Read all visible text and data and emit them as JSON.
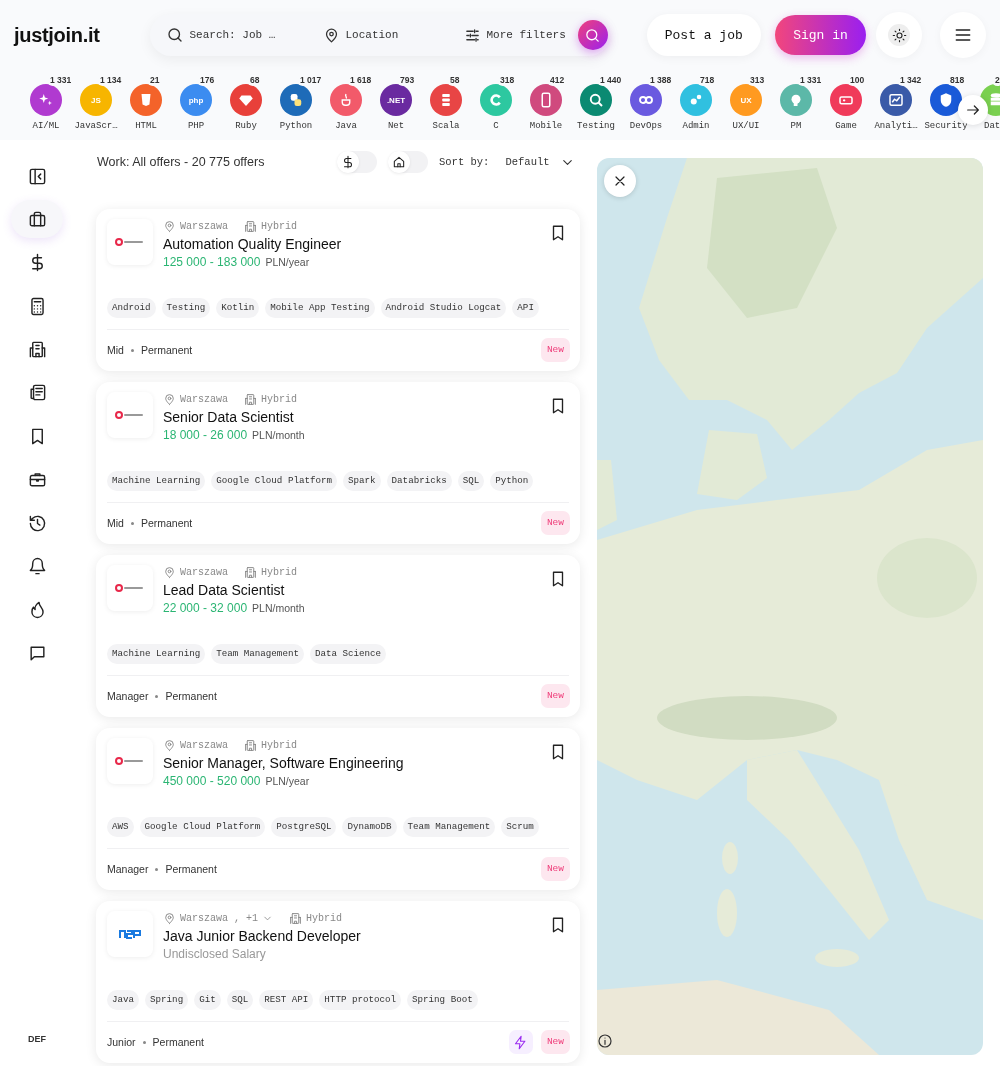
{
  "logo": "justjoin.it",
  "search": {
    "placeholder": "Search: Job …"
  },
  "location": {
    "placeholder": "Location"
  },
  "more_filters": "More filters",
  "post_job": "Post a job",
  "sign_in": "Sign in",
  "categories": [
    {
      "label": "AI/ML",
      "count": "1 331",
      "color": "#b03ad0"
    },
    {
      "label": "JavaScr…",
      "count": "1 134",
      "color": "#f7b500",
      "glyph_text": "JS"
    },
    {
      "label": "HTML",
      "count": "21",
      "color": "#f4632a"
    },
    {
      "label": "PHP",
      "count": "176",
      "color": "#3c8cf0",
      "glyph_text": "php"
    },
    {
      "label": "Ruby",
      "count": "68",
      "color": "#e8403a"
    },
    {
      "label": "Python",
      "count": "1 017",
      "color": "#1e6bb8"
    },
    {
      "label": "Java",
      "count": "1 618",
      "color": "#f25a6a"
    },
    {
      "label": "Net",
      "count": "793",
      "color": "#6a2aa0",
      "glyph_text": ".NET"
    },
    {
      "label": "Scala",
      "count": "58",
      "color": "#e84545"
    },
    {
      "label": "C",
      "count": "318",
      "color": "#2dc8a0"
    },
    {
      "label": "Mobile",
      "count": "412",
      "color": "#d04a7e"
    },
    {
      "label": "Testing",
      "count": "1 440",
      "color": "#0b8a72"
    },
    {
      "label": "DevOps",
      "count": "1 388",
      "color": "#6a5ae0"
    },
    {
      "label": "Admin",
      "count": "718",
      "color": "#30c0e0"
    },
    {
      "label": "UX/UI",
      "count": "313",
      "color": "#ff9a20",
      "glyph_text": "UX"
    },
    {
      "label": "PM",
      "count": "1 331",
      "color": "#5cb8a8"
    },
    {
      "label": "Game",
      "count": "100",
      "color": "#f03a5a"
    },
    {
      "label": "Analyti…",
      "count": "1 342",
      "color": "#3a5aa8"
    },
    {
      "label": "Security",
      "count": "818",
      "color": "#1a5ad8"
    },
    {
      "label": "Dat",
      "count": "2",
      "color": "#7ad050"
    }
  ],
  "nav": {
    "items": [
      {
        "selected": false
      },
      {
        "selected": true
      },
      {
        "selected": false
      },
      {
        "selected": false
      },
      {
        "selected": false
      },
      {
        "selected": false
      },
      {
        "selected": false
      },
      {
        "selected": false
      },
      {
        "selected": false
      },
      {
        "selected": false
      },
      {
        "selected": false
      },
      {
        "selected": false
      }
    ],
    "footer": "DEF"
  },
  "list": {
    "summary": "Work: All offers - 20 775 offers",
    "toggles": [
      {
        "kind": "salary",
        "on": false
      },
      {
        "kind": "remote",
        "on": false
      }
    ],
    "sort_label": "Sort by:",
    "sort_value": "Default"
  },
  "offers": [
    {
      "kind": "ring",
      "location": "Warszawa",
      "location_expandable": false,
      "work_mode": "Hybrid",
      "title": "Automation Quality Engineer",
      "salary": {
        "kind": "range",
        "amount": "125 000 - 183 000",
        "period": "PLN/year"
      },
      "tags": [
        "Android",
        "Testing",
        "Kotlin",
        "Mobile App Testing",
        "Android Studio Logcat",
        "API"
      ],
      "seniority": "Mid",
      "contract": "Permanent",
      "bolt": false,
      "badge": "New"
    },
    {
      "kind": "ring",
      "location": "Warszawa",
      "location_expandable": false,
      "work_mode": "Hybrid",
      "title": "Senior Data Scientist",
      "salary": {
        "kind": "range",
        "amount": "18 000 - 26 000",
        "period": "PLN/month"
      },
      "tags": [
        "Machine Learning",
        "Google Cloud Platform",
        "Spark",
        "Databricks",
        "SQL",
        "Python"
      ],
      "seniority": "Mid",
      "contract": "Permanent",
      "bolt": false,
      "badge": "New"
    },
    {
      "kind": "ring",
      "location": "Warszawa",
      "location_expandable": false,
      "work_mode": "Hybrid",
      "title": "Lead Data Scientist",
      "salary": {
        "kind": "range",
        "amount": "22 000 - 32 000",
        "period": "PLN/month"
      },
      "tags": [
        "Machine Learning",
        "Team Management",
        "Data Science"
      ],
      "seniority": "Manager",
      "contract": "Permanent",
      "bolt": false,
      "badge": "New"
    },
    {
      "kind": "ring",
      "location": "Warszawa",
      "location_expandable": false,
      "work_mode": "Hybrid",
      "title": "Senior Manager, Software Engineering",
      "salary": {
        "kind": "range",
        "amount": "450 000 - 520 000",
        "period": "PLN/year"
      },
      "tags": [
        "AWS",
        "Google Cloud Platform",
        "PostgreSQL",
        "DynamoDB",
        "Team Management",
        "Scrum"
      ],
      "seniority": "Manager",
      "contract": "Permanent",
      "bolt": false,
      "badge": "New"
    },
    {
      "kind": "blocks",
      "location": "Warszawa , +1",
      "location_expandable": true,
      "work_mode": "Hybrid",
      "title": "Java Junior Backend Developer",
      "salary": {
        "kind": "undisclosed",
        "text": "Undisclosed Salary"
      },
      "tags": [
        "Java",
        "Spring",
        "Git",
        "SQL",
        "REST API",
        "HTTP protocol",
        "Spring Boot"
      ],
      "seniority": "Junior",
      "contract": "Permanent",
      "bolt": true,
      "badge": "New"
    }
  ]
}
